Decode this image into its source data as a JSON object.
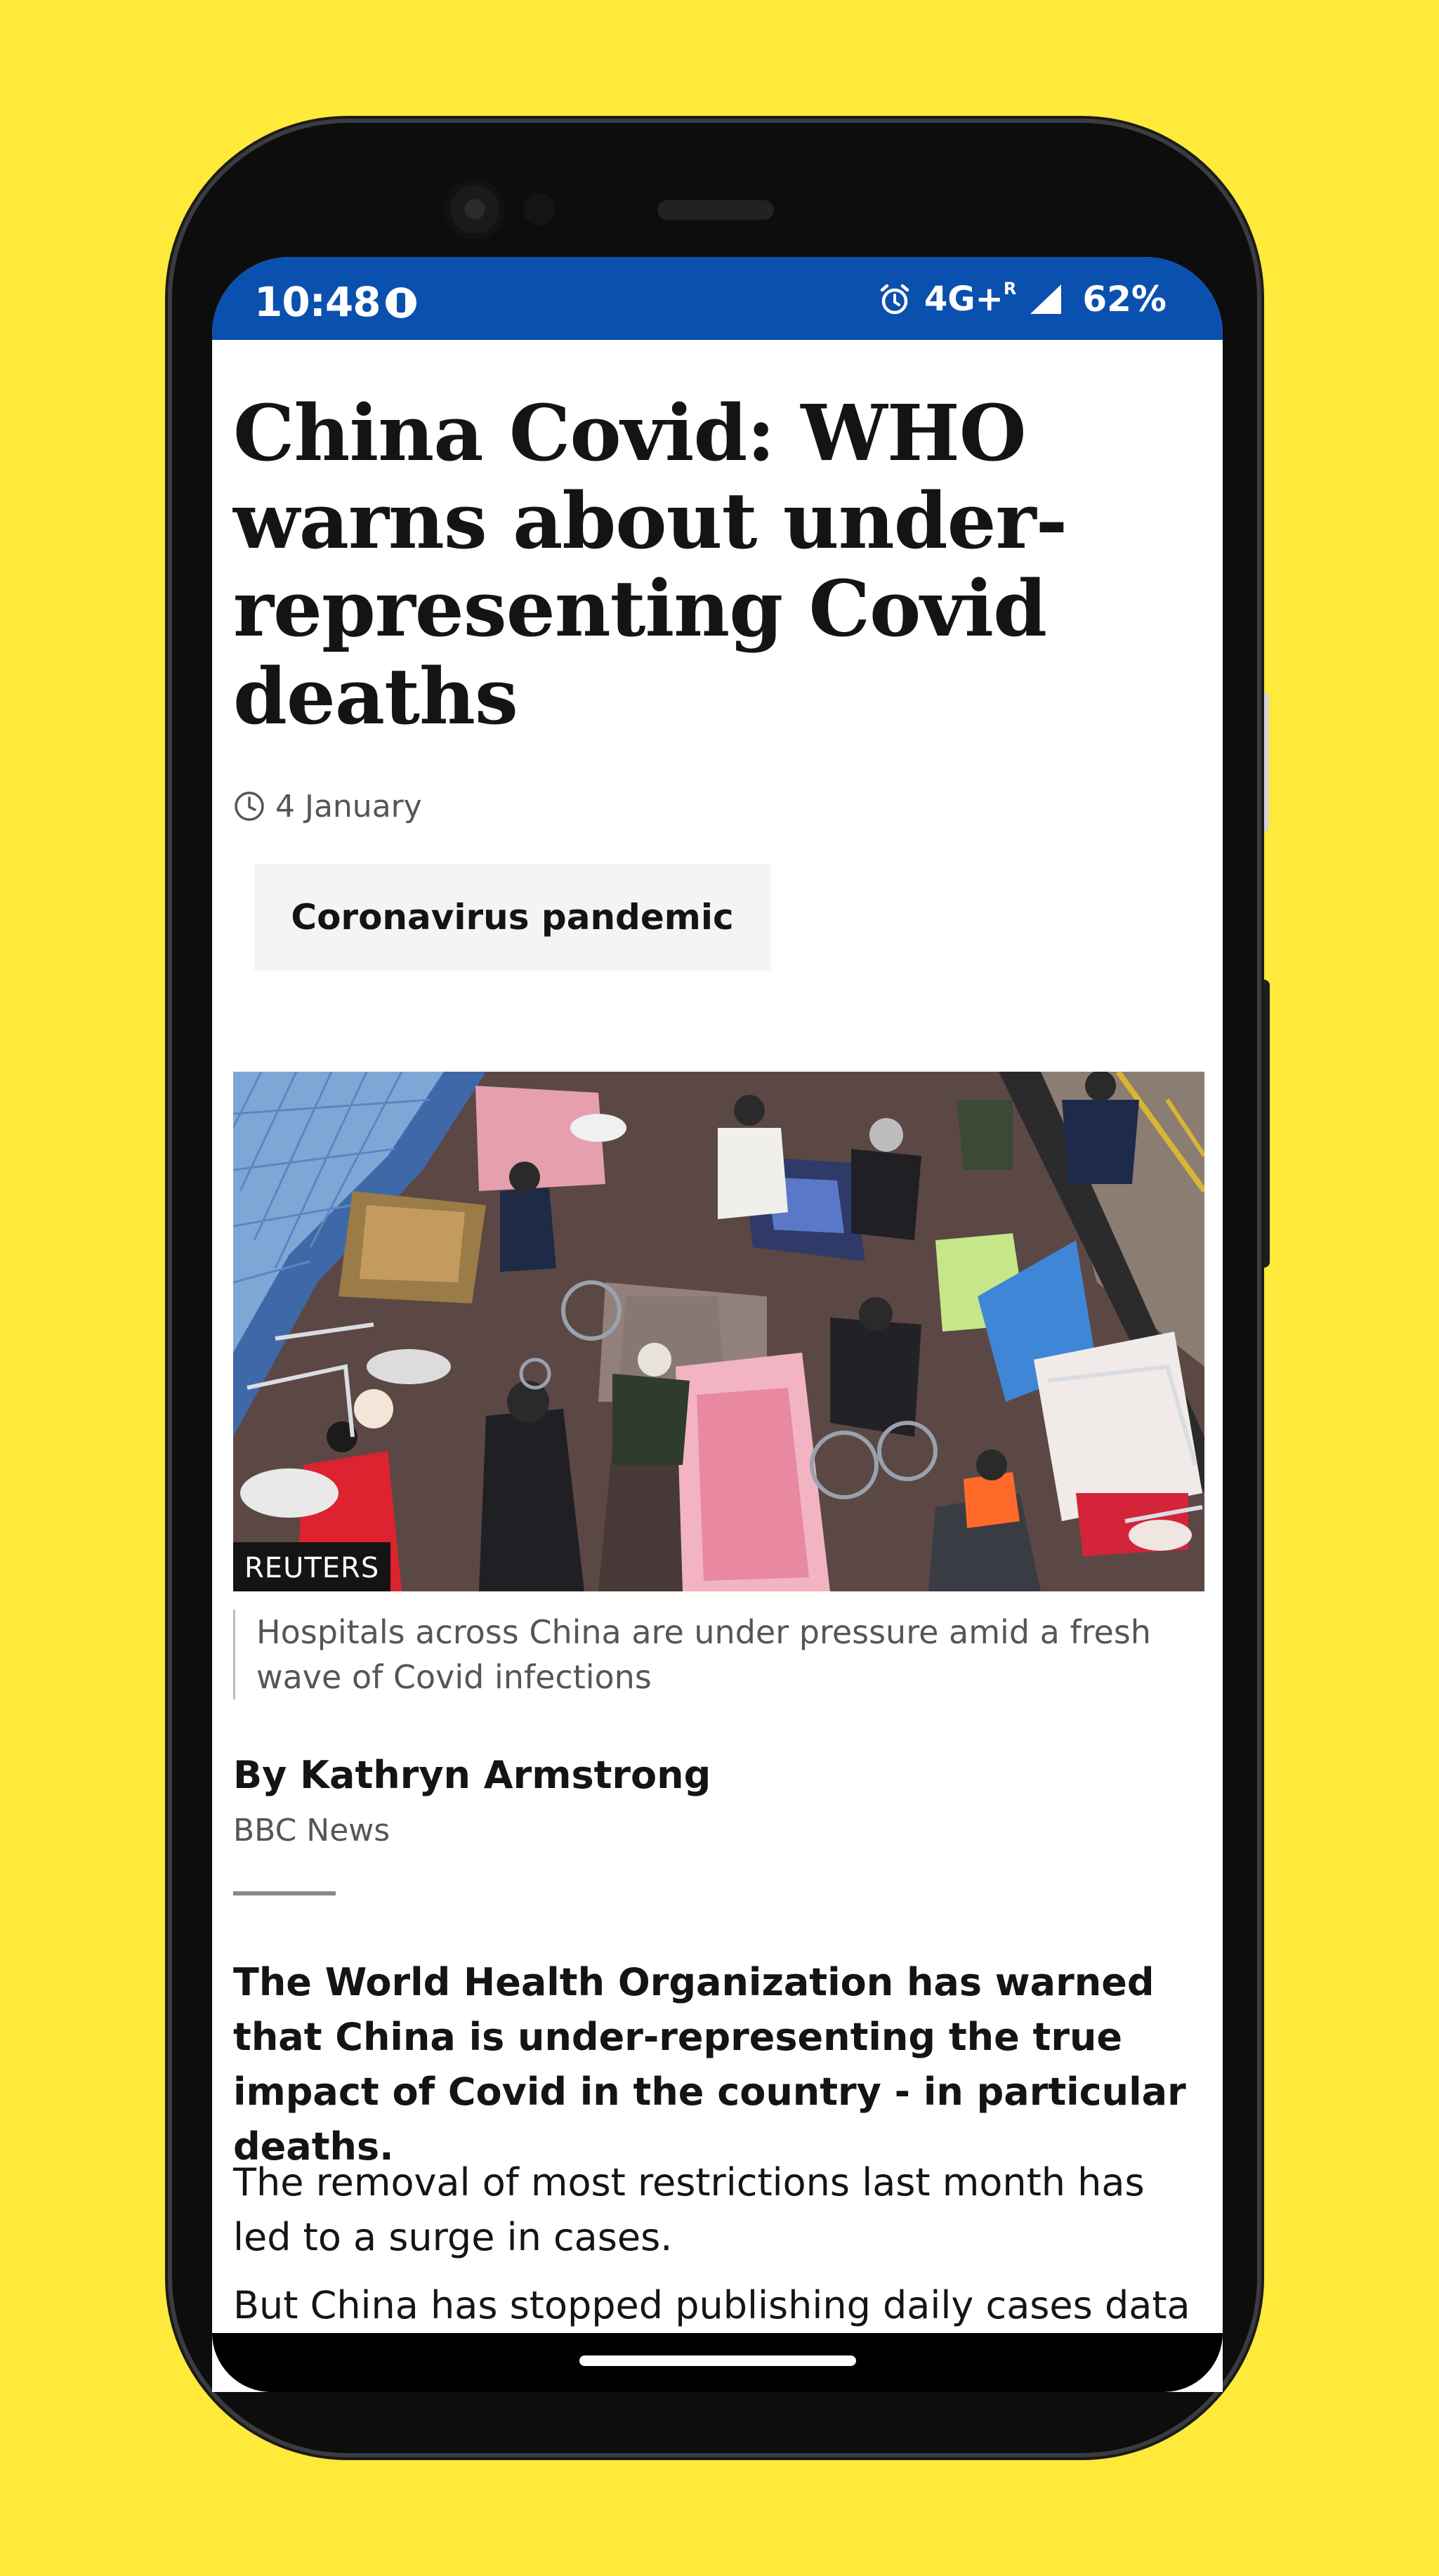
{
  "status_bar": {
    "time": "10:48",
    "network": "4G+",
    "roaming": "R",
    "battery": "62%",
    "icons": [
      "data-saver-icon",
      "alarm-icon",
      "signal-icon"
    ]
  },
  "article": {
    "headline": "China Covid: WHO warns about under-representing Covid deaths",
    "date": "4 January",
    "topic": "Coronavirus pandemic",
    "image_credit": "REUTERS",
    "image_caption": "Hospitals across China are under pressure amid a fresh wave of Covid infections",
    "byline_name": "By Kathryn Armstrong",
    "byline_org": "BBC News",
    "intro": "The World Health Organization has warned that China is under-representing the true impact of Covid in the country - in particular deaths.",
    "paragraphs": [
      "The removal of most restrictions last month has led to a surge in cases.",
      "But China has stopped publishing daily cases data"
    ]
  },
  "colors": {
    "background": "#FFE93A",
    "status_bar": "#0A50AE",
    "text": "#141414",
    "muted_text": "#545658"
  }
}
